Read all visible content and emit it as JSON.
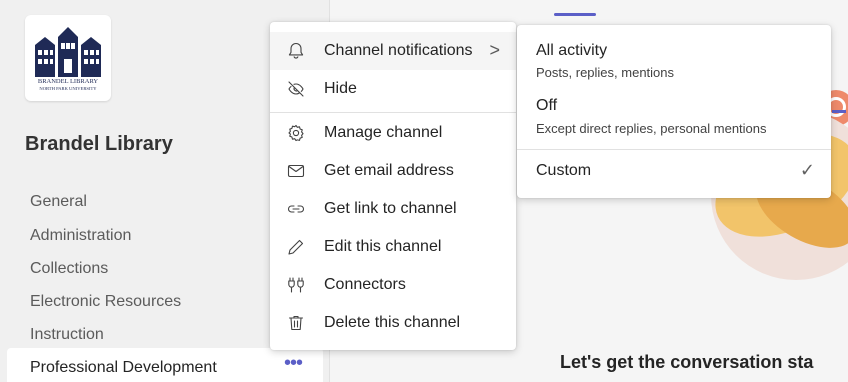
{
  "team": {
    "logo_name": "BRANDEL LIBRARY",
    "logo_sub": "NORTH PARK UNIVERSITY",
    "name": "Brandel Library"
  },
  "channels": [
    {
      "label": "General"
    },
    {
      "label": "Administration"
    },
    {
      "label": "Collections"
    },
    {
      "label": "Electronic Resources"
    },
    {
      "label": "Instruction"
    },
    {
      "label": "Professional Development",
      "more_label": "•••"
    }
  ],
  "menu": {
    "items": [
      {
        "label": "Channel notifications",
        "icon": "bell-icon",
        "chevron": ">"
      },
      {
        "label": "Hide",
        "icon": "eye-off-icon"
      },
      {
        "label": "Manage channel",
        "icon": "gear-icon"
      },
      {
        "label": "Get email address",
        "icon": "mail-icon"
      },
      {
        "label": "Get link to channel",
        "icon": "link-icon"
      },
      {
        "label": "Edit this channel",
        "icon": "pencil-icon"
      },
      {
        "label": "Connectors",
        "icon": "plug-icon"
      },
      {
        "label": "Delete this channel",
        "icon": "trash-icon"
      }
    ]
  },
  "submenu": {
    "options": [
      {
        "title": "All activity",
        "description": "Posts, replies, mentions"
      },
      {
        "title": "Off",
        "description": "Except direct replies, personal mentions"
      },
      {
        "title": "Custom",
        "check": "✓",
        "selected": true
      }
    ]
  },
  "main": {
    "cta": "Let's get the conversation sta"
  },
  "colors": {
    "accent": "#5b5fc7",
    "logo_navy": "#1f2a56"
  }
}
